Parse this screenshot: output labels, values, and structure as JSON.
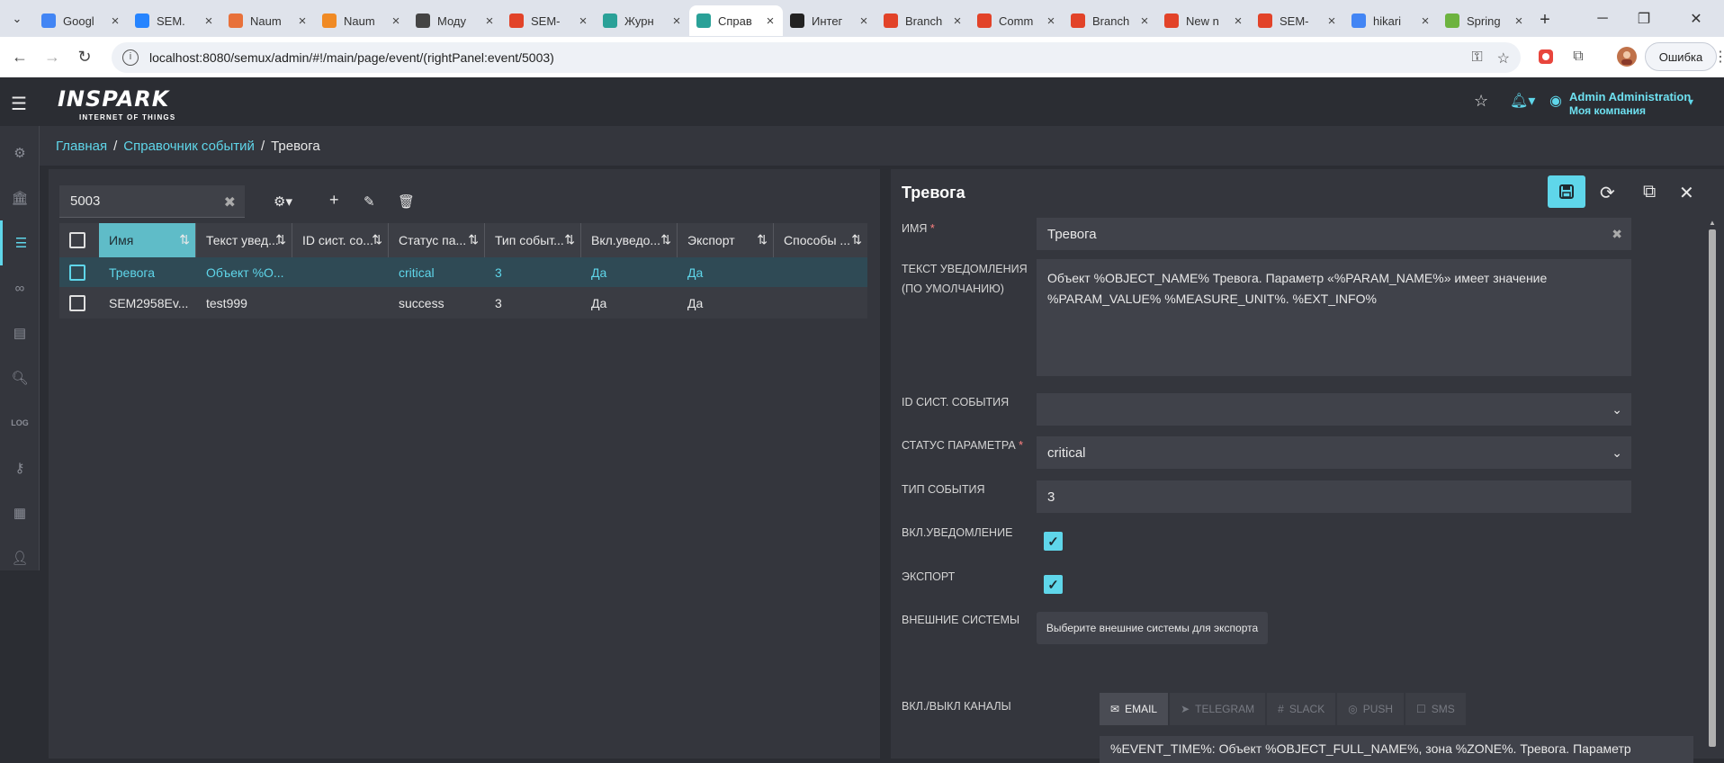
{
  "browser": {
    "tabs": [
      {
        "title": "Googl",
        "color": "#4285f4"
      },
      {
        "title": "SEM.",
        "color": "#2684ff"
      },
      {
        "title": "Naum",
        "color": "#e8713a"
      },
      {
        "title": "Naum",
        "color": "#f08a24"
      },
      {
        "title": "Моду",
        "color": "#444444"
      },
      {
        "title": "SEM-",
        "color": "#e24329"
      },
      {
        "title": "Журн",
        "color": "#2aa198"
      },
      {
        "title": "Справ",
        "color": "#2aa198"
      },
      {
        "title": "Интег",
        "color": "#222222"
      },
      {
        "title": "Branch",
        "color": "#e24329"
      },
      {
        "title": "Comm",
        "color": "#e24329"
      },
      {
        "title": "Branch",
        "color": "#e24329"
      },
      {
        "title": "New n",
        "color": "#e24329"
      },
      {
        "title": "SEM-",
        "color": "#e24329"
      },
      {
        "title": "hikari",
        "color": "#4285f4"
      },
      {
        "title": "Spring",
        "color": "#6db33f"
      }
    ],
    "active_tab_index": 7,
    "url": "localhost:8080/semux/admin/#!/main/page/event/(rightPanel:event/5003)",
    "error_label": "Ошибка"
  },
  "header": {
    "logo": "INSPARK",
    "logo_sub": "INTERNET OF THINGS",
    "user_name": "Admin  Administration",
    "company": "Моя компания"
  },
  "sidebar": {
    "items": [
      "gear-icon",
      "bank-icon",
      "sliders-icon",
      "link-icon",
      "journal-icon",
      "search-doc-icon",
      "log-icon",
      "key-icon",
      "server-icon",
      "user-icon"
    ],
    "active_index": 2,
    "log_label": "LOG"
  },
  "breadcrumb": {
    "home": "Главная",
    "section": "Справочник событий",
    "current": "Тревога"
  },
  "list": {
    "search_value": "5003",
    "columns": [
      "Имя",
      "Текст увед...",
      "ID сист. со...",
      "Статус па...",
      "Тип событ...",
      "Вкл.уведо...",
      "Экспорт",
      "Способы ..."
    ],
    "rows": [
      {
        "name": "Тревога",
        "text": "Объект %О...",
        "sys_id": "",
        "status": "critical",
        "type": "3",
        "notify": "Да",
        "export": "Да",
        "ways": ""
      },
      {
        "name": "SEM2958Ev...",
        "text": "test999",
        "sys_id": "",
        "status": "success",
        "type": "3",
        "notify": "Да",
        "export": "Да",
        "ways": ""
      }
    ]
  },
  "detail": {
    "title": "Тревога",
    "labels": {
      "name": "Имя",
      "text_line1": "Текст уведомления",
      "text_line2": "(по умолчанию)",
      "sys_id": "ID сист. события",
      "status": "Статус параметра",
      "type": "Тип события",
      "notify": "Вкл.уведомление",
      "export": "Экспорт",
      "external": "Внешние системы",
      "channels": "Вкл./выкл каналы"
    },
    "required_mark": "*",
    "values": {
      "name": "Тревога",
      "text_line1": "Объект %OBJECT_NAME% Тревога. Параметр «%PARAM_NAME%» имеет значение",
      "text_line2": "%PARAM_VALUE% %MEASURE_UNIT%.  %EXT_INFO%",
      "sys_id": "",
      "status": "critical",
      "type": "3",
      "notify_checked": true,
      "export_checked": true
    },
    "external_button": "Выберите внешние системы для экспорта",
    "channels": [
      "EMAIL",
      "TELEGRAM",
      "SLACK",
      "PUSH",
      "SMS"
    ],
    "active_channel": "EMAIL",
    "email_template": "%EVENT_TIME%: Объект %OBJECT_FULL_NAME%, зона %ZONE%. Тревога. Параметр"
  },
  "colors": {
    "accent": "#5fd6ea",
    "background": "#2b2d33",
    "panel": "#34363d"
  }
}
